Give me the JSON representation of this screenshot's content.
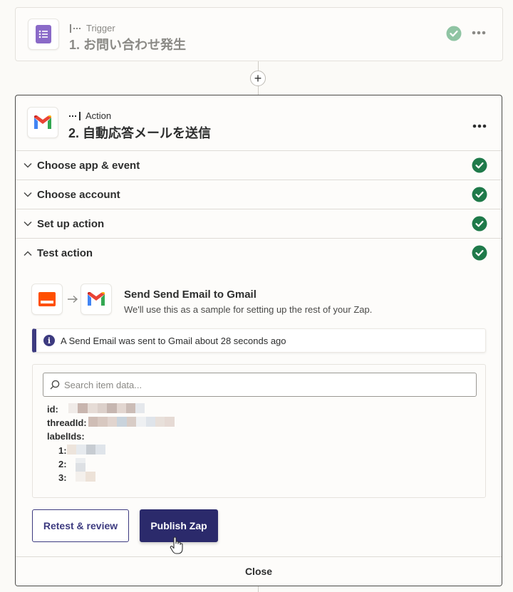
{
  "trigger": {
    "type_label": "Trigger",
    "title": "1. お問い合わせ発生",
    "app_icon": "google-forms-icon",
    "status": "complete"
  },
  "add_step": "+",
  "action": {
    "type_label": "Action",
    "title": "2. 自動応答メールを送信",
    "app_icon": "gmail-icon",
    "sections": [
      {
        "label": "Choose app & event",
        "expanded": false,
        "status": "complete"
      },
      {
        "label": "Choose account",
        "expanded": false,
        "status": "complete"
      },
      {
        "label": "Set up action",
        "expanded": false,
        "status": "complete"
      },
      {
        "label": "Test action",
        "expanded": true,
        "status": "complete"
      }
    ],
    "test": {
      "sample_title": "Send Send Email to Gmail",
      "sample_subtitle": "We'll use this as a sample for setting up the rest of your Zap.",
      "info_message": "A Send Email was sent to Gmail about 28 seconds ago",
      "search_placeholder": "Search item data...",
      "fields": {
        "id": "id:",
        "thread_id": "threadId:",
        "label_ids": "labelIds:",
        "label_1": "1:",
        "label_2": "2:",
        "label_3": "3:"
      }
    },
    "buttons": {
      "retest": "Retest & review",
      "publish": "Publish Zap",
      "close": "Close"
    }
  },
  "colors": {
    "accent": "#2b2a6b",
    "success": "#1f7a4a",
    "trigger_success": "#8fc4a3",
    "forms_purple": "#7c5cb8",
    "webhook_orange": "#ff4f00"
  }
}
